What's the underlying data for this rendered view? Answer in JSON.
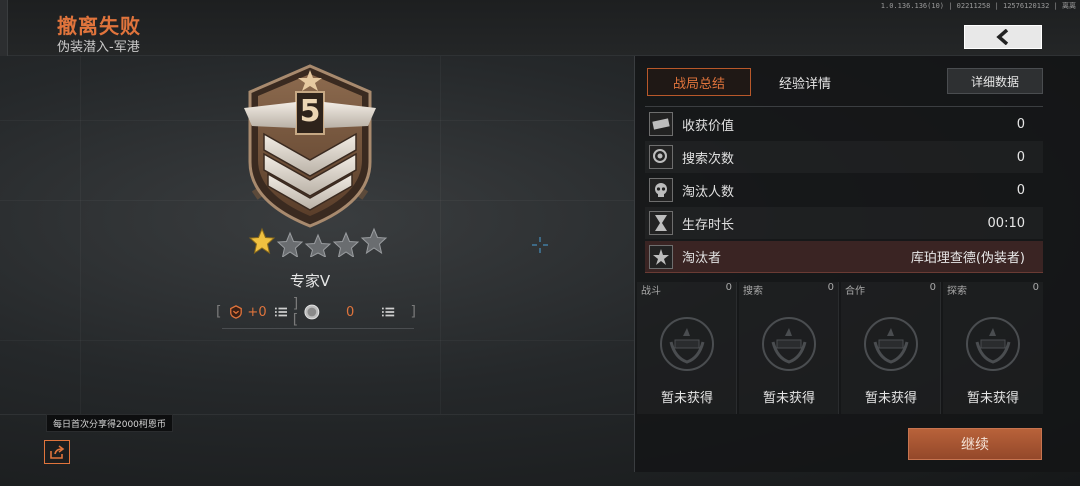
{
  "header": {
    "title": "撤离失败",
    "subtitle": "伪装潜入-军港",
    "build_info": "1.0.136.136(10) | 02211258 | 12576120132 | 离离"
  },
  "rank": {
    "emblem_number": "5",
    "stars_filled": 1,
    "stars_total": 5,
    "name": "专家V",
    "delta": "+0",
    "coin_value": "0",
    "accent_color": "#e0743c"
  },
  "tabs": {
    "summary": "战局总结",
    "experience": "经验详情",
    "detail_button": "详细数据"
  },
  "stats": [
    {
      "label": "收获价值",
      "value": "0",
      "icon": "money-icon"
    },
    {
      "label": "搜索次数",
      "value": "0",
      "icon": "search-icon"
    },
    {
      "label": "淘汰人数",
      "value": "0",
      "icon": "skull-icon"
    },
    {
      "label": "生存时长",
      "value": "00:10",
      "icon": "hourglass-icon"
    },
    {
      "label": "淘汰者",
      "value": "库珀理查德(伪装者)",
      "icon": "star-emblem-icon"
    }
  ],
  "rewards": [
    {
      "category": "战斗",
      "count": "0",
      "status": "暂未获得"
    },
    {
      "category": "搜索",
      "count": "0",
      "status": "暂未获得"
    },
    {
      "category": "合作",
      "count": "0",
      "status": "暂未获得"
    },
    {
      "category": "探索",
      "count": "0",
      "status": "暂未获得"
    }
  ],
  "share_tip": "每日首次分享得2000柯恩币",
  "continue_label": "继续"
}
